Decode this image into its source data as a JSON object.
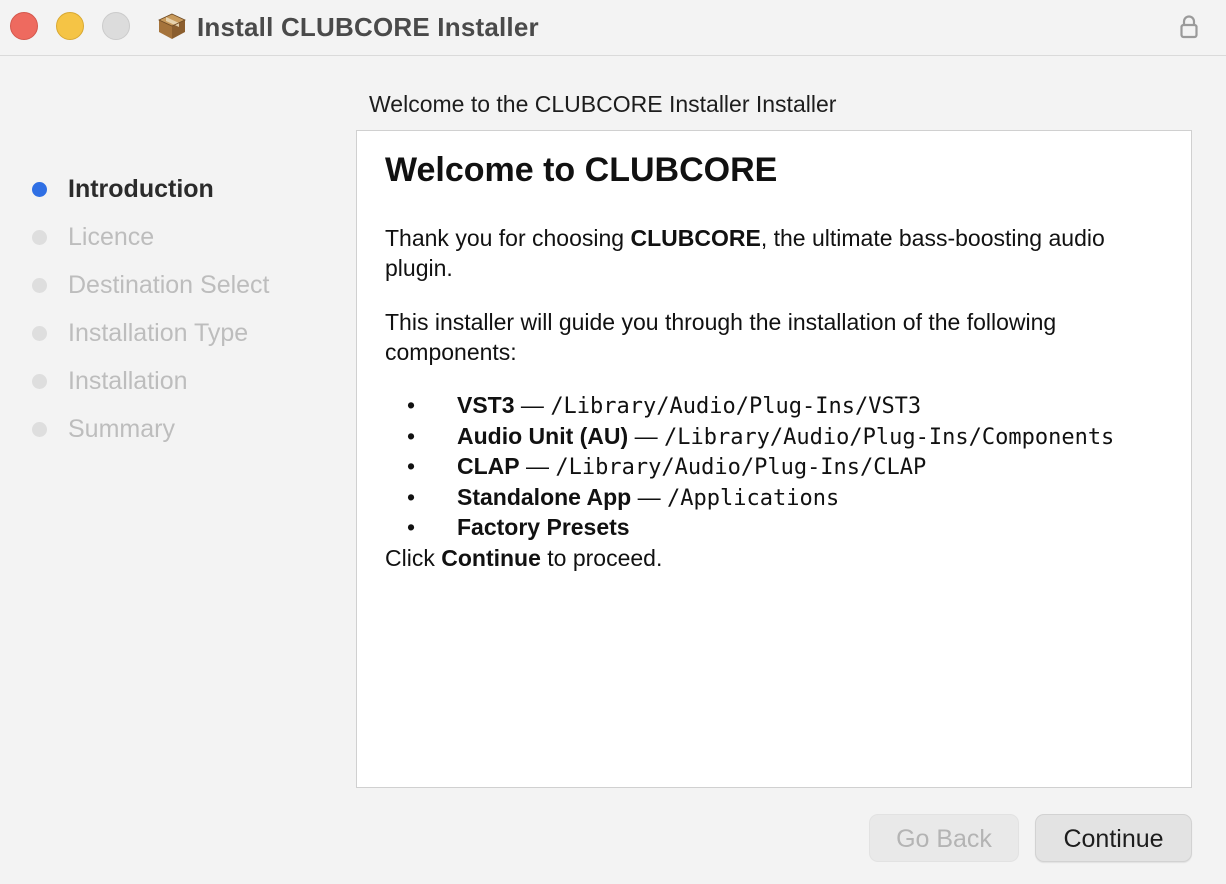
{
  "window": {
    "title": "Install CLUBCORE Installer",
    "icons": {
      "app": "package-icon",
      "lock": "lock-icon"
    }
  },
  "heading": "Welcome to the CLUBCORE Installer Installer",
  "sidebar": {
    "steps": [
      {
        "label": "Introduction",
        "active": true
      },
      {
        "label": "Licence",
        "active": false
      },
      {
        "label": "Destination Select",
        "active": false
      },
      {
        "label": "Installation Type",
        "active": false
      },
      {
        "label": "Installation",
        "active": false
      },
      {
        "label": "Summary",
        "active": false
      }
    ]
  },
  "content": {
    "title": "Welcome to CLUBCORE",
    "intro": {
      "pre": "Thank you for choosing ",
      "bold": "CLUBCORE",
      "post": ", the ultimate bass-boosting audio plugin."
    },
    "guide": "This installer will guide you through the installation of the following components:",
    "components": [
      {
        "name": "VST3",
        "sep": " — ",
        "path": "/Library/Audio/Plug-Ins/VST3"
      },
      {
        "name": "Audio Unit (AU)",
        "sep": " — ",
        "path": "/Library/Audio/Plug-Ins/Components"
      },
      {
        "name": "CLAP",
        "sep": " — ",
        "path": "/Library/Audio/Plug-Ins/CLAP"
      },
      {
        "name": "Standalone App",
        "sep": " — ",
        "path": "/Applications"
      },
      {
        "name": "Factory Presets",
        "sep": "",
        "path": ""
      }
    ],
    "bullet": "•",
    "proceed": {
      "pre": "Click ",
      "bold": "Continue",
      "post": " to proceed."
    }
  },
  "buttons": {
    "back": "Go Back",
    "continue": "Continue"
  },
  "colors": {
    "active_dot": "#2f6fe4",
    "inactive_dot": "#dedede",
    "inactive_text": "#bdbdbd",
    "close": "#ee6a5f",
    "minimize": "#f5c445",
    "zoom": "#dcdcdc"
  }
}
